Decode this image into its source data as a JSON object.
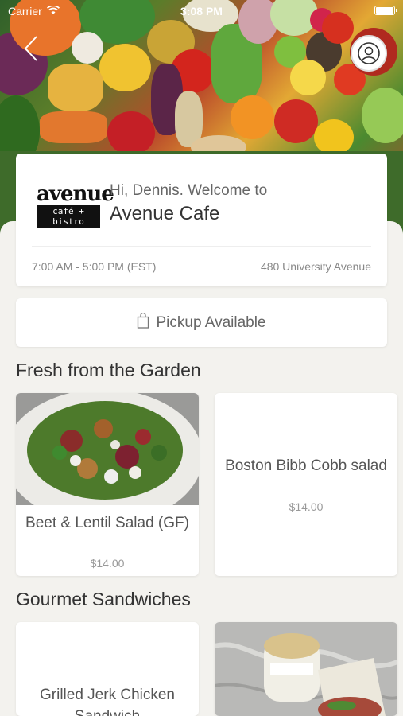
{
  "status_bar": {
    "carrier": "Carrier",
    "time": "3:08 PM"
  },
  "header": {
    "back_icon": "chevron-left-icon",
    "profile_icon": "user-icon"
  },
  "cafe": {
    "greeting": "Hi, Dennis. Welcome to",
    "name": "Avenue Cafe",
    "logo_word": "avenue",
    "logo_sub": "café + bistro",
    "hours": "7:00 AM - 5:00 PM (EST)",
    "address": "480 University Avenue"
  },
  "pickup": {
    "label": "Pickup Available",
    "icon": "shopping-bag-icon"
  },
  "sections": [
    {
      "title": "Fresh from the Garden",
      "items": [
        {
          "name": "Beet & Lentil Salad (GF)",
          "price": "$14.00"
        },
        {
          "name": "Boston Bibb Cobb salad",
          "price": "$14.00"
        }
      ]
    },
    {
      "title": "Gourmet Sandwiches",
      "items": [
        {
          "name": "Grilled Jerk Chicken Sandwich",
          "price": ""
        },
        {
          "name": "",
          "price": ""
        }
      ]
    }
  ],
  "colors": {
    "background": "#f3f2ee",
    "card": "#ffffff",
    "text": "#333333",
    "muted": "#888888"
  }
}
